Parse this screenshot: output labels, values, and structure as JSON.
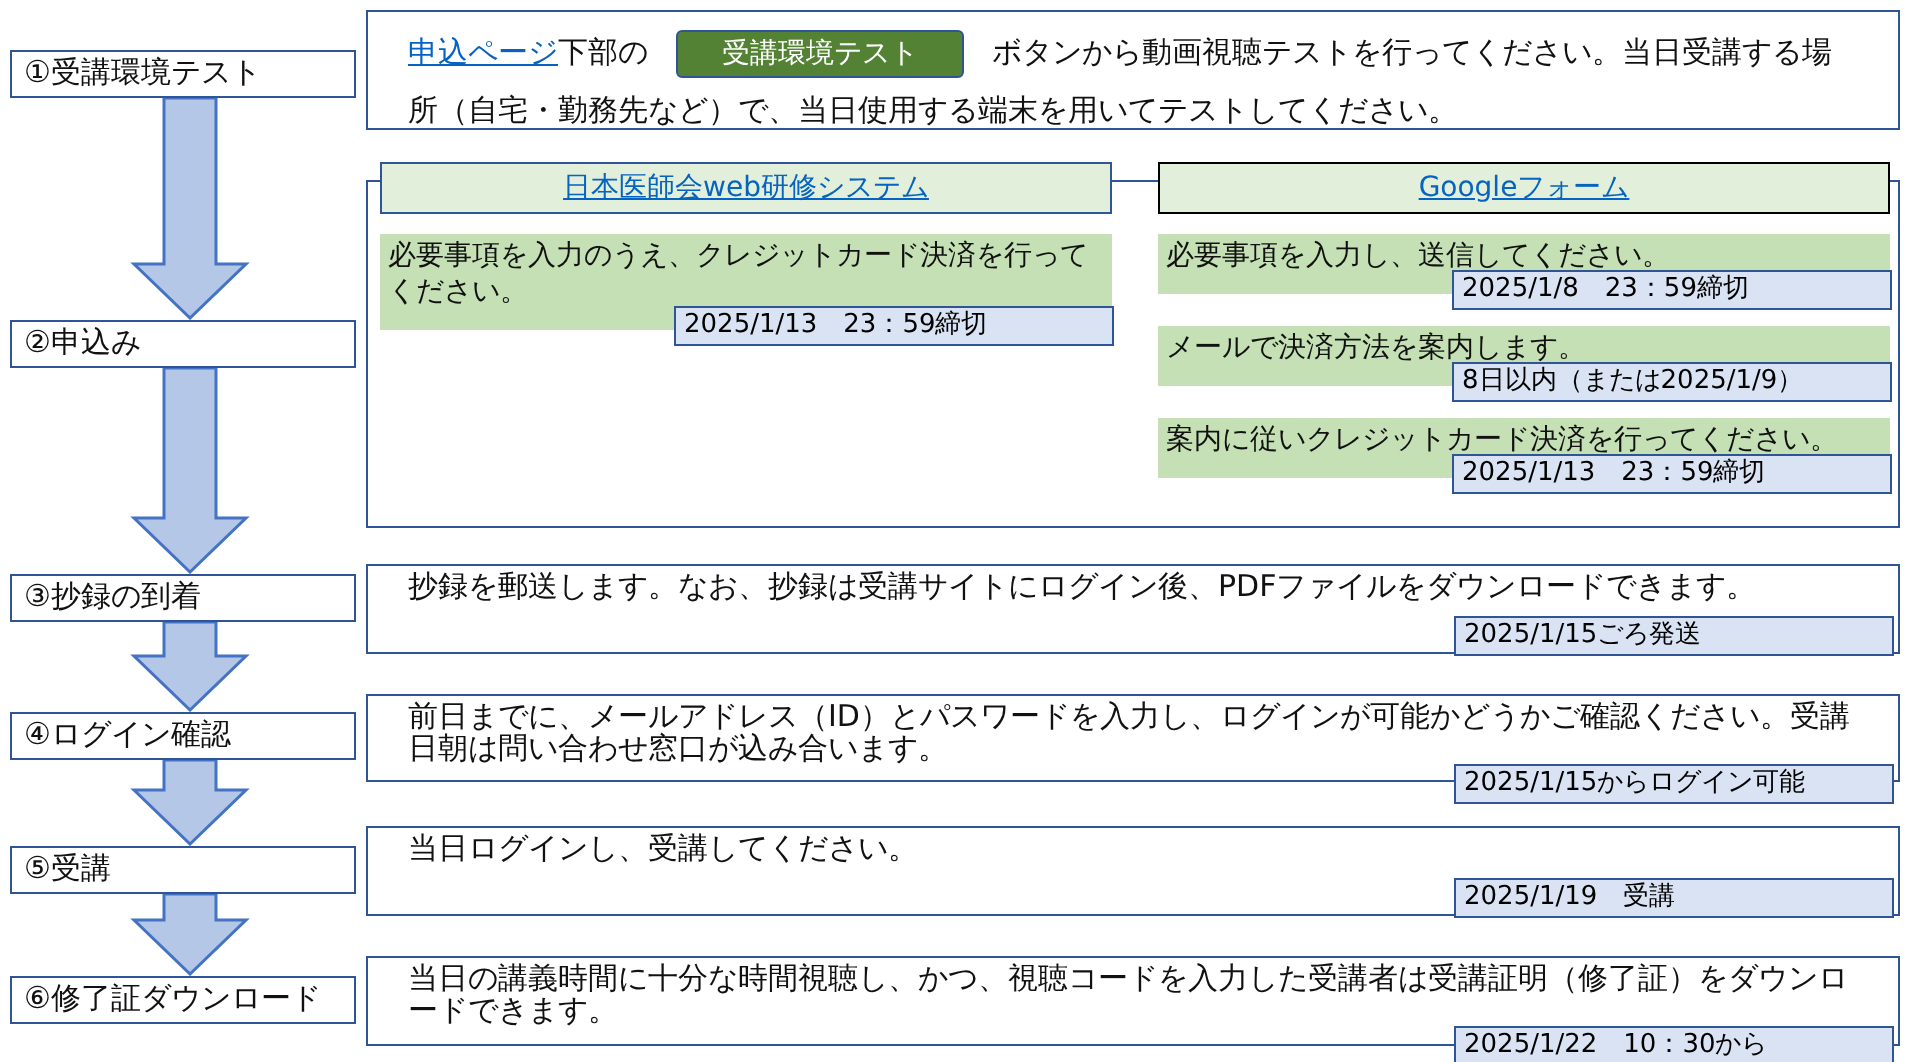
{
  "steps": [
    {
      "label": "①受講環境テスト",
      "kind": "intro",
      "link": "申込ページ",
      "text_1": "下部の",
      "button": "受講環境テスト",
      "text_2": "ボタンから動画視聴テストを行ってください。当日受講する場所（自宅・勤務先など）で、当日使用する端末を用いてテストしてください。"
    },
    {
      "label": "②申込み",
      "kind": "apply",
      "columns": [
        {
          "title": "日本医師会web研修システム",
          "color": "#2f5597",
          "items": [
            {
              "text": "必要事項を入力のうえ、クレジットカード決済を行ってください。",
              "date": "2025/1/13　23：59締切"
            }
          ]
        },
        {
          "title": "Googleフォーム",
          "color": "#000000",
          "items": [
            {
              "text": "必要事項を入力し、送信してください。",
              "date": "2025/1/8　23：59締切"
            },
            {
              "text": "メールで決済方法を案内します。",
              "date": "8日以内（または2025/1/9）"
            },
            {
              "text": "案内に従いクレジットカード決済を行ってください。",
              "date": "2025/1/13　23：59締切"
            }
          ]
        }
      ]
    },
    {
      "label": "③抄録の到着",
      "kind": "info",
      "text": "抄録を郵送します。なお、抄録は受講サイトにログイン後、PDFファイルをダウンロードできます。",
      "date": "2025/1/15ごろ発送"
    },
    {
      "label": "④ログイン確認",
      "kind": "info",
      "text": "前日までに、メールアドレス（ID）とパスワードを入力し、ログインが可能かどうかご確認ください。受講日朝は問い合わせ窓口が込み合います。",
      "date": "2025/1/15からログイン可能"
    },
    {
      "label": "⑤受講",
      "kind": "info",
      "text": "当日ログインし、受講してください。",
      "date": "2025/1/19　受講"
    },
    {
      "label": "⑥修了証ダウンロード",
      "kind": "info",
      "text": "当日の講義時間に十分な時間視聴し、かつ、視聴コードを入力した受講者は受講証明（修了証）をダウンロードできます。",
      "date": "2025/1/22　10：30から"
    }
  ]
}
